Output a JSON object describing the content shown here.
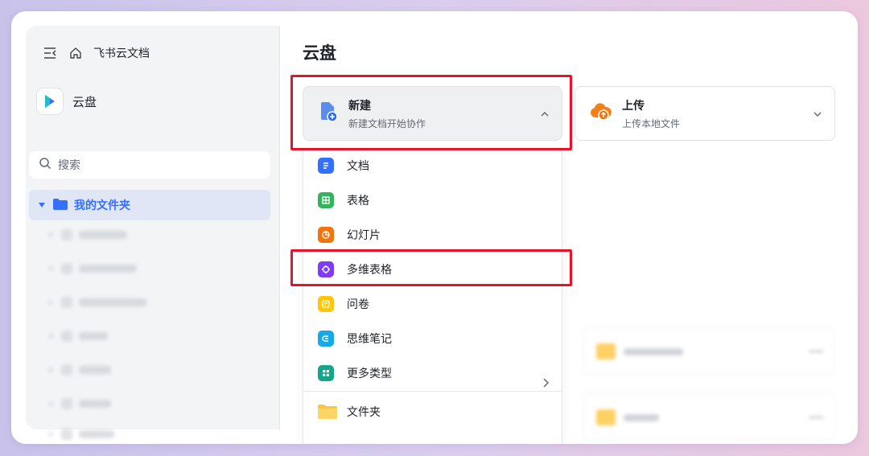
{
  "app": {
    "home_label": "飞书云文档"
  },
  "space": {
    "name": "云盘"
  },
  "search": {
    "placeholder": "搜索"
  },
  "sidebar": {
    "my_folder": "我的文件夹"
  },
  "main": {
    "title": "云盘",
    "new_card": {
      "title": "新建",
      "subtitle": "新建文档开始协作"
    },
    "upload_card": {
      "title": "上传",
      "subtitle": "上传本地文件"
    }
  },
  "menu": {
    "items": [
      {
        "label": "文档",
        "icon": "doc-icon",
        "color": "#3370ff"
      },
      {
        "label": "表格",
        "icon": "sheet-icon",
        "color": "#34b35f"
      },
      {
        "label": "幻灯片",
        "icon": "slides-icon",
        "color": "#f5730d"
      },
      {
        "label": "多维表格",
        "icon": "base-icon",
        "color": "#7f3bf5"
      },
      {
        "label": "问卷",
        "icon": "form-icon",
        "color": "#ffc60a"
      },
      {
        "label": "思维笔记",
        "icon": "mindnote-icon",
        "color": "#14a9e9"
      },
      {
        "label": "更多类型",
        "icon": "more-types-icon",
        "color": "#14a58a"
      },
      {
        "label": "文件夹",
        "icon": "folder-icon",
        "color": "#ffc53d"
      }
    ]
  },
  "colors": {
    "accent": "#3370ff",
    "highlight": "#e8122b"
  }
}
